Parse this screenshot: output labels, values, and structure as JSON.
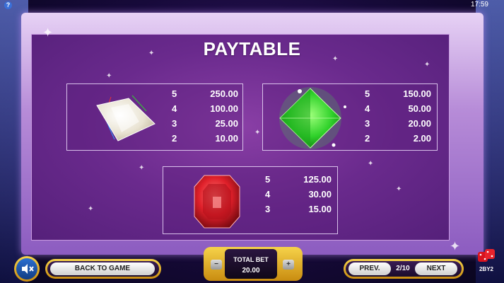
{
  "status": {
    "time": "17:59",
    "help_glyph": "?"
  },
  "title": "PAYTABLE",
  "symbols": [
    {
      "name": "diamond",
      "icon": "white-diamond-gem-icon",
      "color": "#f2efe6",
      "payouts": [
        {
          "count": "5",
          "payout": "250.00"
        },
        {
          "count": "4",
          "payout": "100.00"
        },
        {
          "count": "3",
          "payout": "25.00"
        },
        {
          "count": "2",
          "payout": "10.00"
        }
      ]
    },
    {
      "name": "emerald",
      "icon": "green-emerald-gem-icon",
      "color": "#2fd12a",
      "payouts": [
        {
          "count": "5",
          "payout": "150.00"
        },
        {
          "count": "4",
          "payout": "50.00"
        },
        {
          "count": "3",
          "payout": "20.00"
        },
        {
          "count": "2",
          "payout": "2.00"
        }
      ]
    },
    {
      "name": "ruby",
      "icon": "red-ruby-gem-icon",
      "color": "#e0202a",
      "payouts": [
        {
          "count": "5",
          "payout": "125.00"
        },
        {
          "count": "4",
          "payout": "30.00"
        },
        {
          "count": "3",
          "payout": "15.00"
        }
      ]
    }
  ],
  "controls": {
    "back_label": "BACK TO GAME",
    "total_bet_label": "TOTAL BET",
    "total_bet_value": "20.00",
    "minus_glyph": "−",
    "plus_glyph": "+",
    "prev_label": "PREV.",
    "page_indicator": "2/10",
    "next_label": "NEXT"
  },
  "logo": {
    "text": "2BY2"
  },
  "colors": {
    "accent_gold": "#f6d34a",
    "panel_purple": "#6a2a8d",
    "sound_blue": "#2a6fd1"
  }
}
